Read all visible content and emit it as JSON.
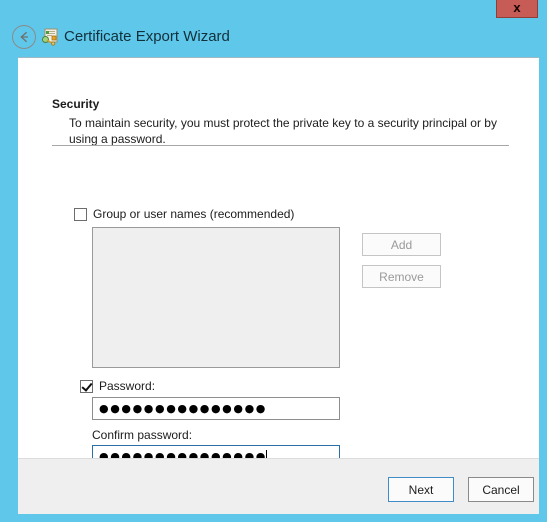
{
  "window": {
    "title": "Certificate Export Wizard",
    "titlebar_color": "#5fc8ea",
    "close_label": "x",
    "back_icon": "back-arrow-icon",
    "title_icon": "certificate-icon"
  },
  "page": {
    "section_title": "Security",
    "section_description": "To maintain security, you must protect the private key to a security principal or by using a password."
  },
  "groups": {
    "checkbox_label": "Group or user names (recommended)",
    "checked": false,
    "listbox_items": [],
    "add_label": "Add",
    "remove_label": "Remove",
    "add_enabled": false,
    "remove_enabled": false
  },
  "password": {
    "checkbox_label": "Password:",
    "checked": true,
    "value": "●●●●●●●●●●●●●●●",
    "confirm_label": "Confirm password:",
    "confirm_value": "●●●●●●●●●●●●●●●",
    "confirm_focused": true
  },
  "footer": {
    "next_label": "Next",
    "cancel_label": "Cancel",
    "default_button": "Next"
  }
}
